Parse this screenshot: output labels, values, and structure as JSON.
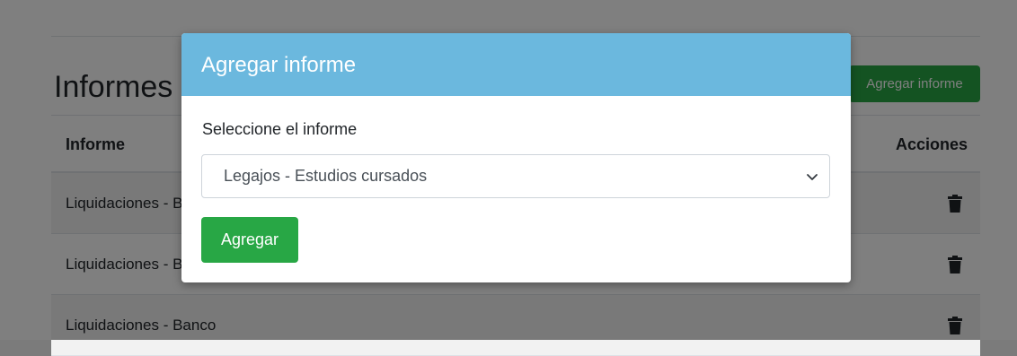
{
  "background_page": {
    "title": "Informes",
    "add_button_label": "Agregar informe",
    "table": {
      "columns": [
        "Informe",
        "Acciones"
      ],
      "rows": [
        {
          "name": "Liquidaciones - Banco"
        },
        {
          "name": "Liquidaciones - Banco"
        },
        {
          "name": "Liquidaciones - Banco"
        }
      ],
      "action_icon": "trash-icon"
    }
  },
  "modal": {
    "title": "Agregar informe",
    "select_label": "Seleccione el informe",
    "selected_option": "Legajos - Estudios cursados",
    "submit_label": "Agregar",
    "header_color": "#6bb8de",
    "submit_color": "#28a745"
  }
}
